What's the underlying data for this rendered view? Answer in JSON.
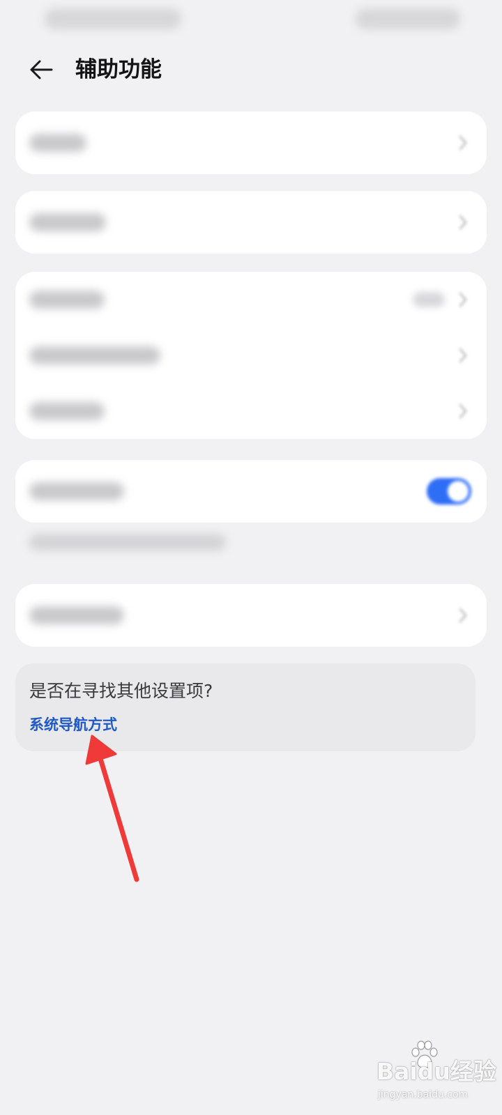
{
  "header": {
    "title": "辅助功能",
    "back_icon": "arrow-left-icon"
  },
  "settings_groups": [
    {
      "rows": [
        {
          "label": "blurred",
          "has_chevron": true
        }
      ]
    },
    {
      "rows": [
        {
          "label": "blurred",
          "has_chevron": true
        }
      ]
    },
    {
      "rows": [
        {
          "label": "blurred",
          "has_value": true,
          "has_chevron": true
        },
        {
          "label": "blurred",
          "has_chevron": true
        },
        {
          "label": "blurred",
          "has_chevron": true
        }
      ]
    },
    {
      "rows": [
        {
          "label": "blurred",
          "toggle_on": true
        }
      ]
    },
    {
      "rows": [
        {
          "label": "blurred",
          "has_chevron": true
        }
      ]
    }
  ],
  "suggestion": {
    "title": "是否在寻找其他设置项?",
    "link": "系统导航方式"
  },
  "annotation": {
    "color": "#f03a3a"
  },
  "watermark": {
    "logo": "Baidu经验",
    "site": "jingyan.baidu.com"
  },
  "colors": {
    "accent": "#2e6df6",
    "link": "#1f58c8",
    "background": "#f1f1f3"
  }
}
